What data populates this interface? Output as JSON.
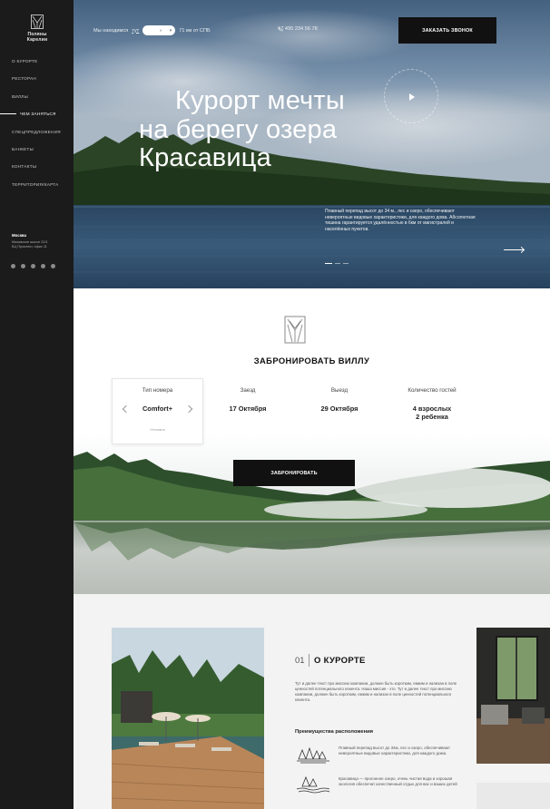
{
  "sidebar": {
    "logo_text": "Поляны\nКарелии",
    "nav": [
      {
        "label": "О КУРОРТЕ"
      },
      {
        "label": "РЕСТОРАН"
      },
      {
        "label": "ВИЛЛЫ"
      },
      {
        "label": "ЧЕМ ЗАНЯТЬСЯ"
      },
      {
        "label": "СПЕЦПРЕДЛОЖЕНИЯ"
      },
      {
        "label": "БАНКЕТЫ"
      },
      {
        "label": "КОНТАКТЫ"
      },
      {
        "label": "ТЕРРИТОРИЯ/КАРТА"
      }
    ],
    "address": {
      "city": "Москва",
      "line1": "Маховское шоссе 22/1",
      "line2": "БЦ Проспект, офис 11"
    },
    "socials": [
      "telegram-icon",
      "vk-icon",
      "ok-icon",
      "instagram-icon",
      "whatsapp-icon"
    ]
  },
  "hero": {
    "location_prefix": "Мы находимся",
    "location_link": "тут",
    "distance": "71 км от СПБ",
    "phone": "+7 495 234 56 78",
    "call_button": "ЗАКАЗАТЬ ЗВОНОК",
    "title_l1": "Курорт мечты",
    "title_l2": "на берегу озера",
    "title_l3": "Красавица",
    "description": "Плавный перепад высот до 34 м., лес и озеро, обеспечивают невероятные видовые характеристики, для каждого дома. Абсолютная тишина гарантируется удалённостью в 6км от магистралей и населённых пунктов."
  },
  "booking": {
    "title": "ЗАБРОНИРОВАТЬ ВИЛЛУ",
    "room_label": "Тип номера",
    "room_value": "Comfort+",
    "clarify": "Уточнить",
    "checkin_label": "Заезд",
    "checkin_value": "17 Октября",
    "checkout_label": "Выезд",
    "checkout_value": "29 Октября",
    "guests_label": "Количество гостей",
    "guests_adults": "4 взрослых",
    "guests_kids": "2 ребенка",
    "button": "ЗАБРОНИРОВАТЬ"
  },
  "about": {
    "number": "01",
    "title": "О КУРОРТЕ",
    "text": "Тут и далее текст про миссию компании, должен быть коротким, емким и нализан в поле ценностей потенциального клиента. Наша миссия - это. Тут и далее текст про миссию компании, должен быть коротким, емким и нализан в поле ценностей потенциального клиента.",
    "advantages_title": "Преимущества расположения",
    "advantages": [
      {
        "text": "Плавный перепад высот до 34м, лес и озеро, обеспечивают невероятные видовые характеристики, для каждого дома."
      },
      {
        "text": "Красавица — прогонное озеро, очень чистая вода и хорошая экология обеспечат качественный отдых для вас и ваших детей"
      }
    ]
  }
}
